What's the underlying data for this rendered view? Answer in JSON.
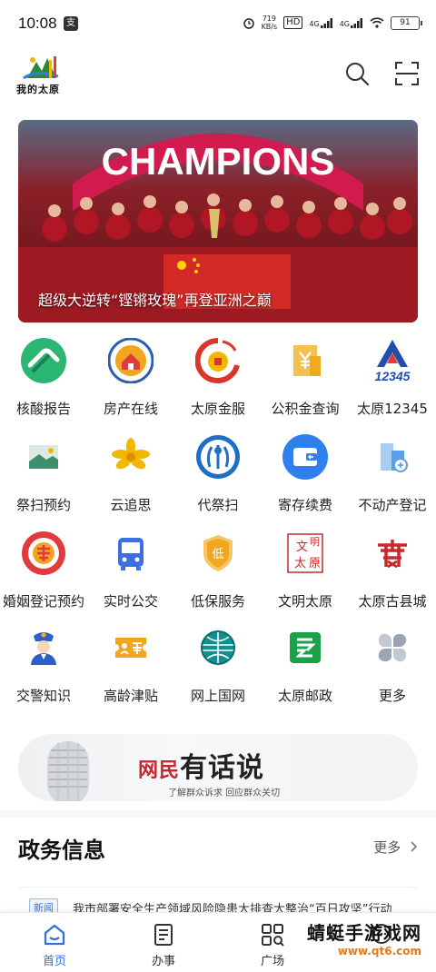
{
  "status": {
    "time": "10:08",
    "app_badge": "支",
    "speed_value": "719",
    "speed_unit": "KB/s",
    "hd_label": "HD",
    "net1": "4G",
    "net2": "4G",
    "battery": "91"
  },
  "header": {
    "logo_text": "我的太原"
  },
  "banner": {
    "headline": "CHAMPIONS",
    "caption": "超级大逆转“铿锵玫瑰”再登亚洲之巅"
  },
  "services": [
    [
      {
        "label": "核酸报告",
        "icon": "hand-badge-icon",
        "color": "#2bb673"
      },
      {
        "label": "房产在线",
        "icon": "house-seal-icon",
        "color": "#2a5db0"
      },
      {
        "label": "太原金服",
        "icon": "coin-dragon-icon",
        "color": "#d9372b"
      },
      {
        "label": "公积金查询",
        "icon": "yen-building-icon",
        "color": "#f0a920"
      },
      {
        "label": "太原12345",
        "icon": "mountain-12345-icon",
        "color": "#1f4fa8"
      }
    ],
    [
      {
        "label": "祭扫预约",
        "icon": "landscape-icon",
        "color": "#3b8f6a"
      },
      {
        "label": "云追思",
        "icon": "chrysanthemum-icon",
        "color": "#f2b705"
      },
      {
        "label": "代祭扫",
        "icon": "wheat-emblem-icon",
        "color": "#1d6fc6"
      },
      {
        "label": "寄存续费",
        "icon": "wallet-icon",
        "color": "#2f80ed"
      },
      {
        "label": "不动产登记",
        "icon": "buildings-icon",
        "color": "#5aa0e6"
      }
    ],
    [
      {
        "label": "婚姻登记预约",
        "icon": "double-happiness-icon",
        "color": "#e23b3b"
      },
      {
        "label": "实时公交",
        "icon": "bus-icon",
        "color": "#3d6fe0"
      },
      {
        "label": "低保服务",
        "icon": "shield-low-icon",
        "color": "#f2a51e"
      },
      {
        "label": "文明太原",
        "icon": "seal-stamp-icon",
        "color": "#c8282e"
      },
      {
        "label": "太原古县城",
        "icon": "gate-icon",
        "color": "#c8282e"
      }
    ],
    [
      {
        "label": "交警知识",
        "icon": "police-icon",
        "color": "#2c5fc9"
      },
      {
        "label": "高龄津贴",
        "icon": "ticket-icon",
        "color": "#f2a51e"
      },
      {
        "label": "网上国网",
        "icon": "state-grid-icon",
        "color": "#11908f"
      },
      {
        "label": "太原邮政",
        "icon": "post-icon",
        "color": "#1aa14a"
      },
      {
        "label": "更多",
        "icon": "more-petals-icon",
        "color": "#9aa4b4"
      }
    ]
  ],
  "promo": {
    "title_red": "网民",
    "title": "有话说",
    "subtitle": "了解群众诉求 回应群众关切"
  },
  "gov_info": {
    "title": "政务信息",
    "more": "更多",
    "news": [
      {
        "tag": "新闻",
        "text": "我市部署安全生产领域风险隐患大排查大整治“百日攻坚”行动"
      }
    ]
  },
  "tabbar": [
    {
      "label": "首页",
      "icon": "home-icon",
      "active": true
    },
    {
      "label": "办事",
      "icon": "document-list-icon",
      "active": false
    },
    {
      "label": "广场",
      "icon": "grid-search-icon",
      "active": false
    },
    {
      "label": "",
      "icon": "chat-icon",
      "active": false
    }
  ],
  "watermark": {
    "big": "蜻蜓手游戏网",
    "small": "www.qt6.com"
  }
}
